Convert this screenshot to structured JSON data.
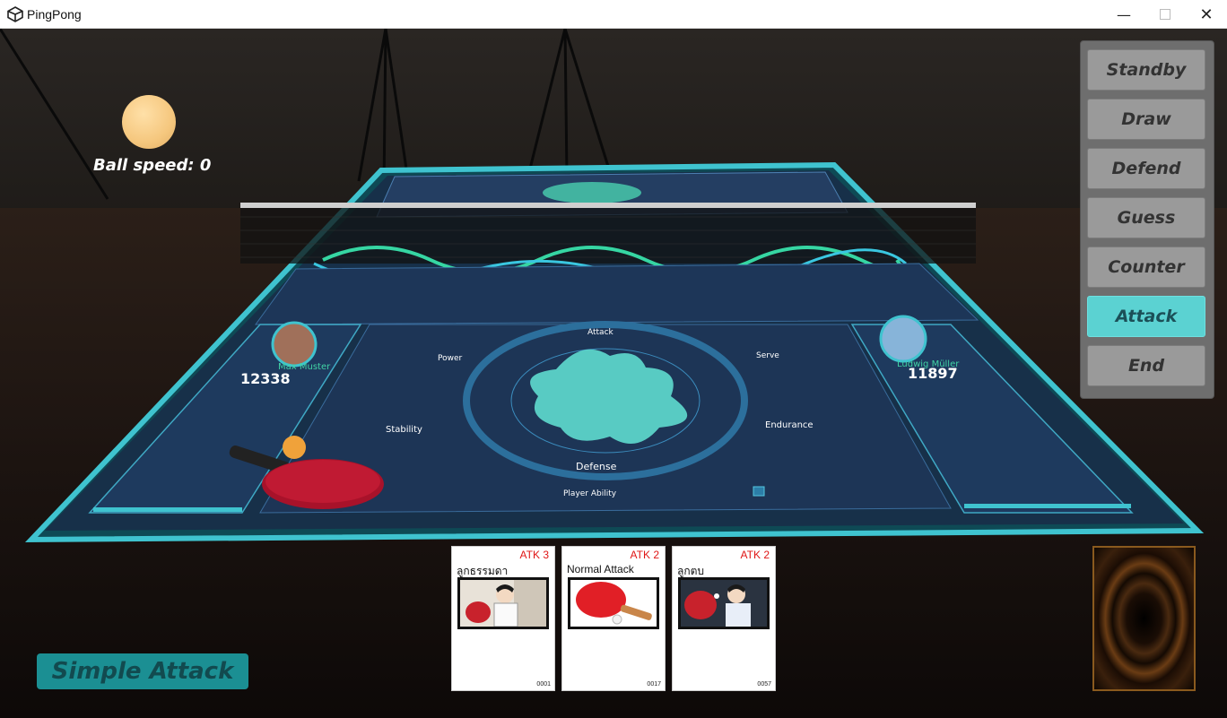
{
  "window": {
    "title": "PingPong"
  },
  "hud": {
    "ball_speed_label": "Ball speed: 0"
  },
  "phases": {
    "items": [
      {
        "label": "Standby",
        "active": false
      },
      {
        "label": "Draw",
        "active": false
      },
      {
        "label": "Defend",
        "active": false
      },
      {
        "label": "Guess",
        "active": false
      },
      {
        "label": "Counter",
        "active": false
      },
      {
        "label": "Attack",
        "active": true
      },
      {
        "label": "End",
        "active": false
      }
    ]
  },
  "action_button": {
    "label": "Simple Attack"
  },
  "hand": [
    {
      "atk": "ATK 3",
      "name": "ลูกธรรมดา",
      "number": "0001",
      "art_icon": "player-serve-illustration"
    },
    {
      "atk": "ATK 2",
      "name": "Normal Attack",
      "number": "0017",
      "art_icon": "paddle-and-ball-illustration"
    },
    {
      "atk": "ATK 2",
      "name": "ลูกตบ",
      "number": "0057",
      "art_icon": "player-smash-illustration"
    }
  ],
  "table_display": {
    "left_player": {
      "name": "Max Muster",
      "score": "12338"
    },
    "right_player": {
      "name": "Ludwig Müller",
      "score": "11897"
    },
    "radar_labels": {
      "top": "Attack",
      "left_top": "Power",
      "right_top": "Serve",
      "left_bottom": "Stability",
      "right_bottom": "Endurance",
      "bottom": "Defense"
    },
    "footer_label": "Player Ability"
  },
  "colors": {
    "accent_cyan": "#5bd2d2",
    "atk_red": "#e01515",
    "panel_gray": "#6e6e6e"
  }
}
